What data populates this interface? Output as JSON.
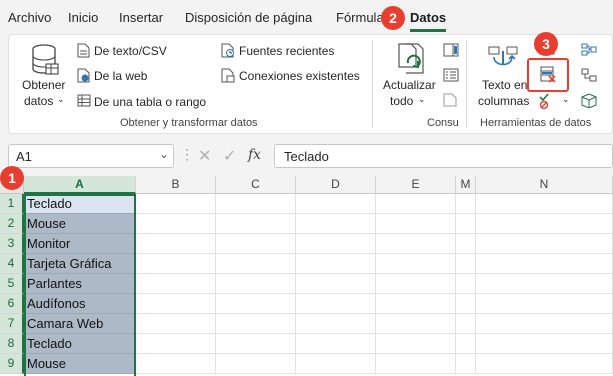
{
  "tabs": [
    {
      "label": "Archivo"
    },
    {
      "label": "Inicio"
    },
    {
      "label": "Insertar"
    },
    {
      "label": "Disposición de página"
    },
    {
      "label": "Fórmula"
    },
    {
      "label": "Datos"
    }
  ],
  "ribbon": {
    "get_data": {
      "line1": "Obtener",
      "line2": "datos"
    },
    "from_text_csv": "De texto/CSV",
    "from_web": "De la web",
    "from_table": "De una tabla o rango",
    "recent_sources": "Fuentes recientes",
    "existing_connections": "Conexiones existentes",
    "group_get_transform": "Obtener y transformar datos",
    "refresh_all": {
      "line1": "Actualizar",
      "line2": "todo"
    },
    "group_queries": "Consu",
    "text_to_columns": {
      "line1": "Texto en",
      "line2": "columnas"
    },
    "group_data_tools": "Herramientas de datos"
  },
  "badges": [
    "1",
    "2",
    "3"
  ],
  "name_box": {
    "value": "A1"
  },
  "formula_bar": {
    "fx": "fx",
    "value": "Teclado"
  },
  "columns": [
    "A",
    "B",
    "C",
    "D",
    "E",
    "M",
    "N"
  ],
  "rows": [
    {
      "num": "1",
      "a": "Teclado"
    },
    {
      "num": "2",
      "a": "Mouse"
    },
    {
      "num": "3",
      "a": "Monitor"
    },
    {
      "num": "4",
      "a": "Tarjeta Gráfica"
    },
    {
      "num": "5",
      "a": "Parlantes"
    },
    {
      "num": "6",
      "a": "Audífonos"
    },
    {
      "num": "7",
      "a": "Camara Web"
    },
    {
      "num": "8",
      "a": "Teclado"
    },
    {
      "num": "9",
      "a": "Mouse"
    }
  ],
  "colors": {
    "accent": "#217346",
    "badge": "#e63e2f",
    "selection": "#aeb9c7"
  }
}
